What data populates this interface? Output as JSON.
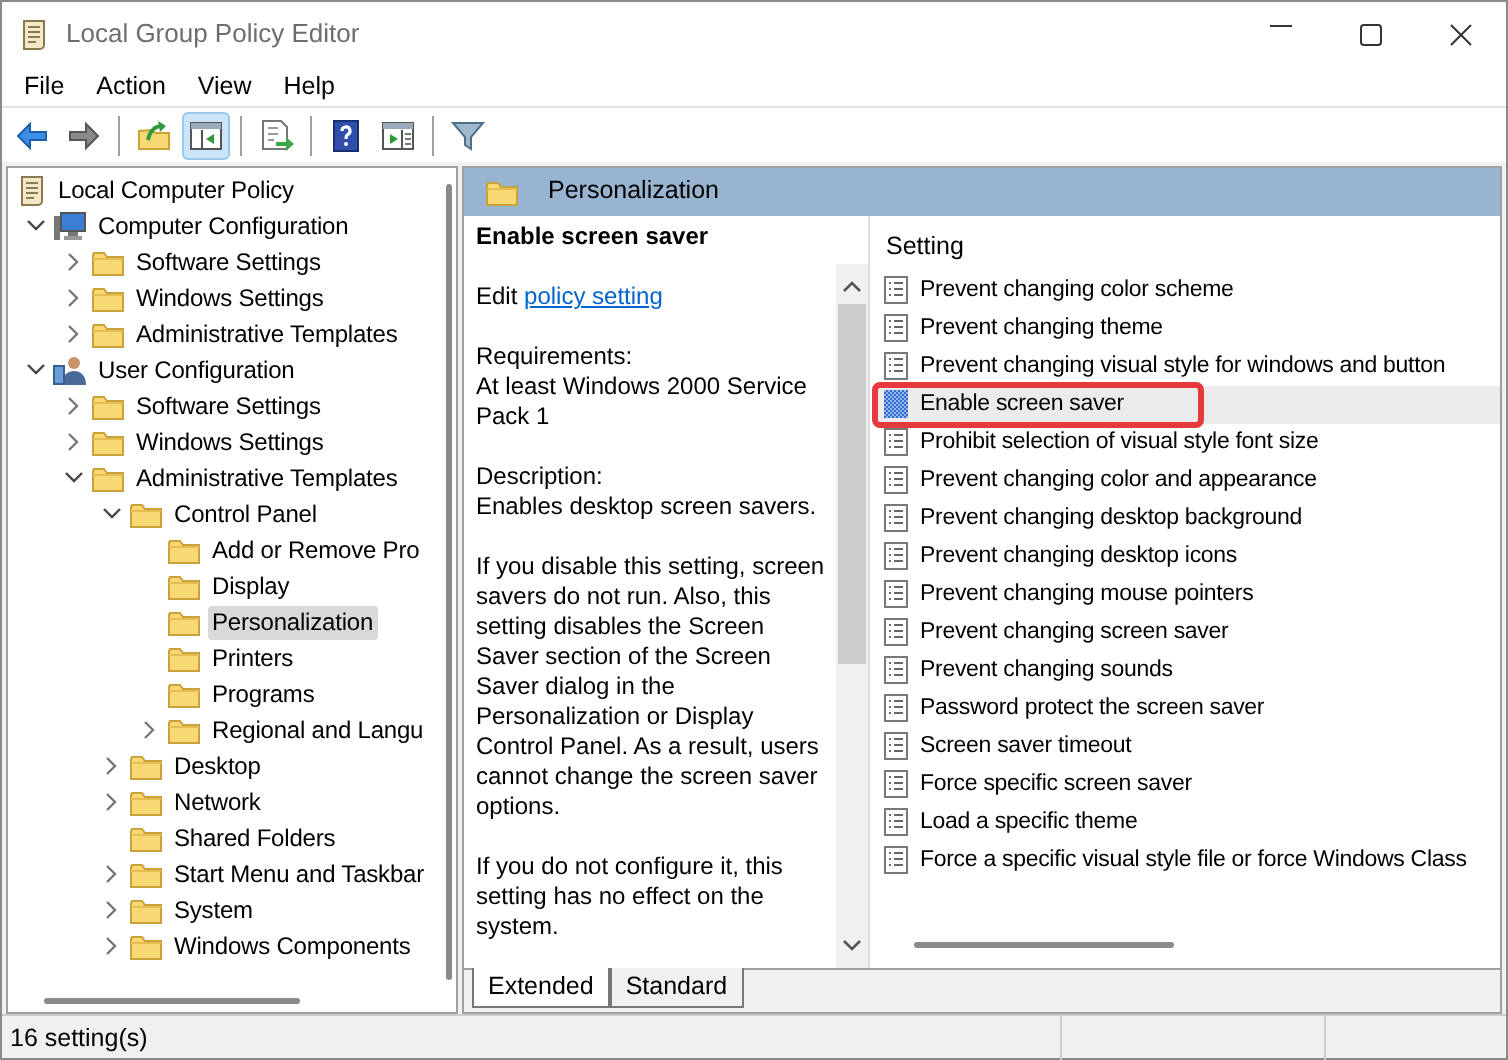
{
  "window": {
    "title": "Local Group Policy Editor"
  },
  "menu": [
    "File",
    "Action",
    "View",
    "Help"
  ],
  "toolbar": [
    [
      {
        "kind": "back",
        "on": false
      },
      {
        "kind": "forward",
        "on": false
      }
    ],
    [
      {
        "kind": "up",
        "on": false
      },
      {
        "kind": "tree",
        "on": true
      }
    ],
    [
      {
        "kind": "export",
        "on": false
      }
    ],
    [
      {
        "kind": "help",
        "on": false
      },
      {
        "kind": "actionpane",
        "on": false
      }
    ],
    [
      {
        "kind": "filter",
        "on": false
      }
    ]
  ],
  "tree": [
    {
      "label": "Local Computer Policy",
      "kind": "root",
      "selected": false,
      "children": [
        {
          "label": "Computer Configuration",
          "kind": "branch",
          "expanded": true,
          "selected": false,
          "children": [
            {
              "label": "Software Settings",
              "kind": "branch",
              "expanded": false,
              "selected": false
            },
            {
              "label": "Windows Settings",
              "kind": "branch",
              "expanded": false,
              "selected": false
            },
            {
              "label": "Administrative Templates",
              "kind": "branch",
              "expanded": false,
              "selected": false
            }
          ]
        },
        {
          "label": "User Configuration",
          "kind": "branch",
          "expanded": true,
          "selected": false,
          "children": [
            {
              "label": "Software Settings",
              "kind": "branch",
              "expanded": false,
              "selected": false
            },
            {
              "label": "Windows Settings",
              "kind": "branch",
              "expanded": false,
              "selected": false
            },
            {
              "label": "Administrative Templates",
              "kind": "branch",
              "expanded": true,
              "selected": false,
              "children": [
                {
                  "label": "Control Panel",
                  "kind": "branch",
                  "expanded": true,
                  "selected": false,
                  "children": [
                    {
                      "label": "Add or Remove Pro",
                      "kind": "leaf",
                      "selected": false
                    },
                    {
                      "label": "Display",
                      "kind": "leaf",
                      "selected": false
                    },
                    {
                      "label": "Personalization",
                      "kind": "leaf",
                      "selected": true
                    },
                    {
                      "label": "Printers",
                      "kind": "leaf",
                      "selected": false
                    },
                    {
                      "label": "Programs",
                      "kind": "leaf",
                      "selected": false
                    },
                    {
                      "label": "Regional and Langu",
                      "kind": "branch",
                      "expanded": false,
                      "selected": false
                    }
                  ]
                },
                {
                  "label": "Desktop",
                  "kind": "branch",
                  "expanded": false,
                  "selected": false
                },
                {
                  "label": "Network",
                  "kind": "branch",
                  "expanded": false,
                  "selected": false
                },
                {
                  "label": "Shared Folders",
                  "kind": "leaf",
                  "selected": false
                },
                {
                  "label": "Start Menu and Taskbar",
                  "kind": "branch",
                  "expanded": false,
                  "selected": false
                },
                {
                  "label": "System",
                  "kind": "branch",
                  "expanded": false,
                  "selected": false
                },
                {
                  "label": "Windows Components",
                  "kind": "branch",
                  "expanded": false,
                  "selected": false
                }
              ]
            }
          ]
        }
      ]
    }
  ],
  "details": {
    "header": "Personalization",
    "title": "Enable screen saver",
    "edit_prefix": "Edit",
    "edit_link": "policy setting",
    "blocks": [
      [
        "Requirements:",
        "At least Windows 2000 Service Pack 1"
      ],
      [
        "Description:",
        "Enables desktop screen savers."
      ],
      [
        "If you disable this setting, screen savers do not run. Also, this setting disables the Screen Saver section of the Screen Saver dialog in the Personalization or Display Control Panel. As a result, users cannot change the screen saver options."
      ],
      [
        "If you do not configure it, this setting has no effect on the system."
      ]
    ]
  },
  "settings_list": {
    "column": "Setting",
    "items": [
      {
        "label": "Prevent changing color scheme",
        "selected": false,
        "highlighted": false
      },
      {
        "label": "Prevent changing theme",
        "selected": false,
        "highlighted": false
      },
      {
        "label": "Prevent changing visual style for windows and button",
        "selected": false,
        "highlighted": false
      },
      {
        "label": "Enable screen saver",
        "selected": true,
        "highlighted": true
      },
      {
        "label": "Prohibit selection of visual style font size",
        "selected": false,
        "highlighted": false
      },
      {
        "label": "Prevent changing color and appearance",
        "selected": false,
        "highlighted": false
      },
      {
        "label": "Prevent changing desktop background",
        "selected": false,
        "highlighted": false
      },
      {
        "label": "Prevent changing desktop icons",
        "selected": false,
        "highlighted": false
      },
      {
        "label": "Prevent changing mouse pointers",
        "selected": false,
        "highlighted": false
      },
      {
        "label": "Prevent changing screen saver",
        "selected": false,
        "highlighted": false
      },
      {
        "label": "Prevent changing sounds",
        "selected": false,
        "highlighted": false
      },
      {
        "label": "Password protect the screen saver",
        "selected": false,
        "highlighted": false
      },
      {
        "label": "Screen saver timeout",
        "selected": false,
        "highlighted": false
      },
      {
        "label": "Force specific screen saver",
        "selected": false,
        "highlighted": false
      },
      {
        "label": "Load a specific theme",
        "selected": false,
        "highlighted": false
      },
      {
        "label": "Force a specific visual style file or force Windows Class",
        "selected": false,
        "highlighted": false
      }
    ]
  },
  "tabs": [
    {
      "label": "Extended",
      "selected": true
    },
    {
      "label": "Standard",
      "selected": false
    }
  ],
  "status_bar": "16 setting(s)"
}
